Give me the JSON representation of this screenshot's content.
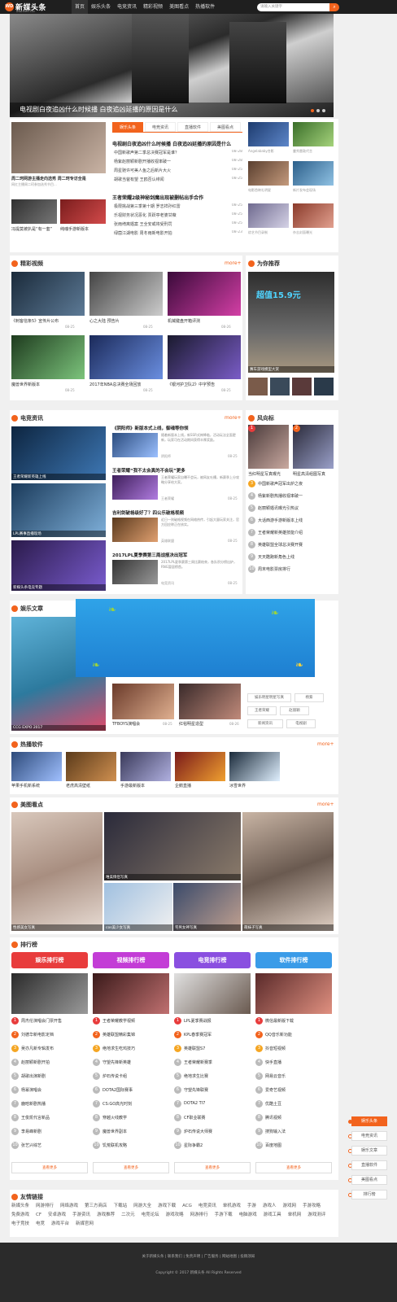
{
  "header": {
    "logo_text": "新媒头条",
    "logo_badge": "WD",
    "logo_sub": "www.94fm.com",
    "nav": [
      "首页",
      "娱乐头条",
      "电竞资讯",
      "精彩视频",
      "美图看点",
      "热播软件"
    ],
    "search_placeholder": "请输入关键字",
    "search_icon": "search-icon"
  },
  "hero": {
    "caption": "电视剧白夜追凶什么时候播 白夜追凶延播的原因是什么"
  },
  "top_left": {
    "items": [
      {
        "title": "周二珂网游主播走向选秀 周二珂专访全是",
        "meta": "网红主播周二珂参加选秀节目..."
      },
      {
        "title": "冯提莫被扒是“有一套”",
        "sub": "冯提莫事件"
      },
      {
        "title": "纯魂手游新版本",
        "sub": "游戏新版"
      }
    ]
  },
  "tabs": [
    "娱乐头条",
    "电竞资讯",
    "直播软件",
    "美图看点"
  ],
  "news": {
    "blocks": [
      {
        "head": "电视剧白夜追凶什么时候播 白夜追凶延播的原因是什么",
        "lines": [
          {
            "t": "中国新歌声第二季总决赛冠军是谁？",
            "d": "08-28"
          },
          {
            "t": "杨紫赵丽颖新剧开播收视率破一",
            "d": "08-28"
          },
          {
            "t": "周星驰许可美人鱼之后新片大火",
            "d": "08-25"
          },
          {
            "t": "胡歌当爸有望 王鸥否认绯闻",
            "d": "08-25"
          }
        ]
      },
      {
        "head": "王者荣耀2级神秘剑魔出现被删帖出手合作",
        "lines": [
          {
            "t": "极限挑战第三季第十期 罗志祥孙红雷",
            "d": "08-25"
          },
          {
            "t": "乐视财务状况恶化 贾跃亭老婆甘薇",
            "d": "08-25"
          },
          {
            "t": "张雨绮离婚案 王全安或将受刑罚",
            "d": "08-25"
          },
          {
            "t": "绿茵江湖电影 周冬雨新电影开拍",
            "d": "08-23"
          }
        ]
      }
    ]
  },
  "right_grid": [
    {
      "title": "Angelababy合影",
      "d": "08-25"
    },
    {
      "title": "曼秀雷敦代言",
      "d": "08-28"
    },
    {
      "title": "电影首映礼明星",
      "d": "08-26"
    },
    {
      "title": "新片发布会现场",
      "d": "08-26"
    },
    {
      "title": "综艺节目录制",
      "d": "08-26"
    },
    {
      "title": "杂志封面曝光",
      "d": "08-25"
    }
  ],
  "videos": {
    "title": "精彩视频",
    "more": "more+",
    "items": [
      {
        "title": "《刺客信条5》宣传片公布",
        "d": "08-25"
      },
      {
        "title": "心之大陆 预告片",
        "d": "08-25"
      },
      {
        "title": "机械键盘开箱评测",
        "d": "08-26"
      },
      {
        "title": "魔兽世界新版本",
        "d": "08-25"
      },
      {
        "title": "2017年NBA总决赛全场回放",
        "d": "08-25"
      },
      {
        "title": "《银河护卫队2》中字预告",
        "d": "08-25"
      }
    ]
  },
  "recommend": {
    "title": "为你推荐",
    "big_caption": "赛车游戏模型大赏",
    "ad_text": "超值15.9元"
  },
  "esports": {
    "title": "电竞资讯",
    "more": "more+",
    "left_captions": [
      "王者荣耀新英雄上线",
      "LPL赛事直播现场",
      "新媒头条电竞专题"
    ],
    "items": [
      {
        "head": "《阴阳师》新版本式上线，御魂等你领",
        "desc": "随着新版本上线，新SSR式神降临，活动玩法全面更新，玩家可在活动期间获得丰厚奖励。",
        "src": "阴阳师",
        "d": "08-25"
      },
      {
        "head": "王者荣耀“我不太会真的不会玩”更多",
        "desc": "王者荣耀玩家自曝不会玩，被网友吐槽，新赛季上分攻略分享给大家。",
        "src": "王者荣耀",
        "d": "08-25"
      },
      {
        "head": "吉利剑破格级好了？四公乐破格视频",
        "desc": "近日一则破格视频在网络热传，引起大量玩家关注，官方回应称正在核实。",
        "src": "英雄联盟",
        "d": "08-25"
      },
      {
        "head": "2017LPL夏季赛第三周战报决出冠军",
        "desc": "2017LPL夏季赛第三周比赛结束，各队积分榜出炉，RNG暂居榜首。",
        "src": "电竞资讯",
        "d": "08-25"
      }
    ]
  },
  "hotlist": {
    "title": "风向标",
    "items": [
      "当红明星写真曝光",
      "明星高清组图写真",
      "中国新歌声冠军出炉之夜",
      "杨紫新剧热播收视率破一",
      "赵丽颖婚讯曝光引热议",
      "大话西游手游新版本上线",
      "王者荣耀新英雄技能介绍",
      "英雄联盟全球总决赛开赛",
      "天天酷跑新角色上线",
      "周末电影票房排行"
    ]
  },
  "ent": {
    "title": "娱乐文章",
    "cover_caption": "CCG EXPO 2017",
    "items": [
      {
        "t": "TFBOYS演唱会",
        "d": "08-25"
      },
      {
        "t": "红毯明星造型",
        "d": "08-26"
      }
    ],
    "tags": [
      "娱乐明星明星写真",
      "杨紫",
      "王者荣耀",
      "赵丽颖",
      "新闻资讯",
      "电视剧"
    ]
  },
  "software": {
    "title": "热播软件",
    "more": "more+",
    "items": [
      "苹果手机新系统",
      "老虎高清壁纸",
      "手游最新版本",
      "企鹅直播",
      "冰雪世界"
    ]
  },
  "beauty": {
    "title": "美图看点",
    "more": "more+",
    "captions": [
      "性感美女写真",
      "唯美情侣写真",
      "cos美少女写真",
      "宅男女神写真",
      "萌妹子写真"
    ]
  },
  "ranking": {
    "title": "排行榜",
    "cats": [
      {
        "label": "娱乐排行榜",
        "color": "#e83c3c"
      },
      {
        "label": "视频排行榜",
        "color": "#c33dd6"
      },
      {
        "label": "电竞排行榜",
        "color": "#8a4fe0"
      },
      {
        "label": "软件排行榜",
        "color": "#3a9be8"
      }
    ],
    "more_label": "查看更多",
    "lists": [
      [
        "周杰伦演唱会门票开售",
        "刘德华新电影定档",
        "吴亦凡新专辑发布",
        "赵丽颖新剧开拍",
        "胡歌出演新剧",
        "杨幂演唱会",
        "鹿晗新剧热播",
        "王俊凯代言新品",
        "李易峰新剧",
        "张艺兴综艺"
      ],
      [
        "王者荣耀教学视频",
        "英雄联盟精彩集锦",
        "绝地求生吃鸡技巧",
        "守望先锋新英雄",
        "炉石传说卡组",
        "DOTA2国际赛事",
        "CS:GO高光时刻",
        "穿越火线教学",
        "魔兽世界副本",
        "饥荒联机攻略"
      ],
      [
        "LPL夏季赛战报",
        "KPL春季赛冠军",
        "英雄联盟S7",
        "王者荣耀新赛季",
        "绝地求生比赛",
        "守望先锋联赛",
        "DOTA2 TI7",
        "CF职业联赛",
        "炉石传说大师赛",
        "星际争霸2"
      ],
      [
        "微信最新版下载",
        "QQ音乐新功能",
        "抖音短视频",
        "快手直播",
        "网易云音乐",
        "爱奇艺视频",
        "优酷土豆",
        "腾讯视频",
        "搜狗输入法",
        "百度地图"
      ]
    ]
  },
  "links": {
    "title": "友情链接",
    "items": [
      "新媒头条",
      "网游排行",
      "网络游戏",
      "第三方商店",
      "下载站",
      "网游大全",
      "游戏下载",
      "ACG",
      "电竞资讯",
      "单机游戏",
      "手游",
      "游戏人",
      "游戏网",
      "手游攻略",
      "免费游戏",
      "CF",
      "安卓游戏",
      "手游资讯",
      "游戏推荐",
      "二次元",
      "电竞论坛",
      "游戏攻略",
      "网游排行",
      "手游下载",
      "电脑游戏",
      "游戏工具",
      "单机网",
      "游戏测评",
      "电子竞技",
      "电竞",
      "游戏平台",
      "新媒官网"
    ]
  },
  "sidebar": [
    "娱乐头条",
    "电竞资讯",
    "娱乐文章",
    "直播软件",
    "美图看点",
    "排行榜"
  ],
  "footer": {
    "line1": "关于新媒头条 | 联系我们 | 免责声明 | 广告服务 | 网站地图 | 投稿须知",
    "line2": "Copyright © 2017 新媒头条 All Rights Reserved"
  }
}
